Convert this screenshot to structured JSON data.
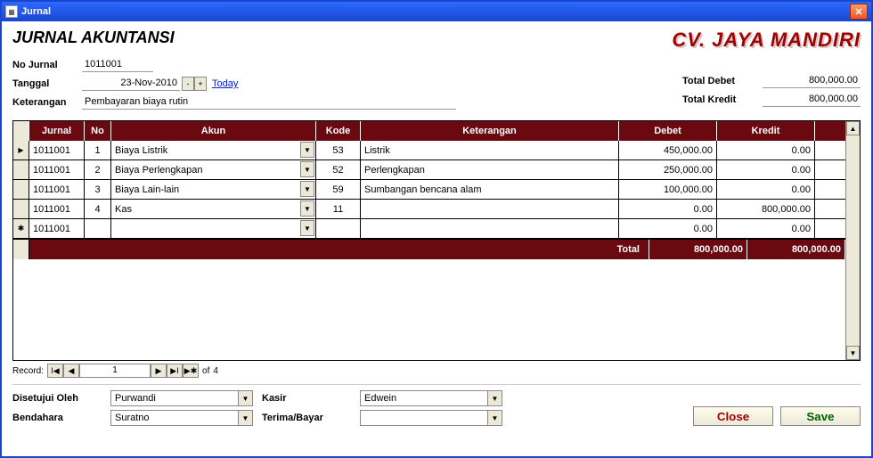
{
  "window": {
    "title": "Jurnal"
  },
  "header": {
    "page_title": "JURNAL AKUNTANSI",
    "company": "CV. JAYA MANDIRI"
  },
  "form": {
    "no_jurnal_label": "No Jurnal",
    "no_jurnal": "1011001",
    "tanggal_label": "Tanggal",
    "tanggal": "23-Nov-2010",
    "today_label": "Today",
    "keterangan_label": "Keterangan",
    "keterangan": "Pembayaran biaya rutin",
    "total_debet_label": "Total Debet",
    "total_debet": "800,000.00",
    "total_kredit_label": "Total Kredit",
    "total_kredit": "800,000.00"
  },
  "grid": {
    "headers": {
      "jurnal": "Jurnal",
      "no": "No",
      "akun": "Akun",
      "kode": "Kode",
      "keterangan": "Keterangan",
      "debet": "Debet",
      "kredit": "Kredit"
    },
    "rows": [
      {
        "marker": "current",
        "jurnal": "1011001",
        "no": "1",
        "akun": "Biaya Listrik",
        "kode": "53",
        "keterangan": "Listrik",
        "debet": "450,000.00",
        "kredit": "0.00"
      },
      {
        "marker": "",
        "jurnal": "1011001",
        "no": "2",
        "akun": "Biaya Perlengkapan",
        "kode": "52",
        "keterangan": "Perlengkapan",
        "debet": "250,000.00",
        "kredit": "0.00"
      },
      {
        "marker": "",
        "jurnal": "1011001",
        "no": "3",
        "akun": "Biaya Lain-lain",
        "kode": "59",
        "keterangan": "Sumbangan bencana alam",
        "debet": "100,000.00",
        "kredit": "0.00"
      },
      {
        "marker": "",
        "jurnal": "1011001",
        "no": "4",
        "akun": "Kas",
        "kode": "11",
        "keterangan": "",
        "debet": "0.00",
        "kredit": "800,000.00"
      },
      {
        "marker": "new",
        "jurnal": "1011001",
        "no": "",
        "akun": "",
        "kode": "",
        "keterangan": "",
        "debet": "0.00",
        "kredit": "0.00"
      }
    ],
    "footer": {
      "total_label": "Total",
      "debet": "800,000.00",
      "kredit": "800,000.00"
    }
  },
  "nav": {
    "label": "Record:",
    "position": "1",
    "of_label": "of",
    "total": "4"
  },
  "bottom": {
    "disetujui_label": "Disetujui Oleh",
    "disetujui": "Purwandi",
    "bendahara_label": "Bendahara",
    "bendahara": "Suratno",
    "kasir_label": "Kasir",
    "kasir": "Edwein",
    "terima_label": "Terima/Bayar",
    "terima": ""
  },
  "buttons": {
    "close": "Close",
    "save": "Save"
  }
}
